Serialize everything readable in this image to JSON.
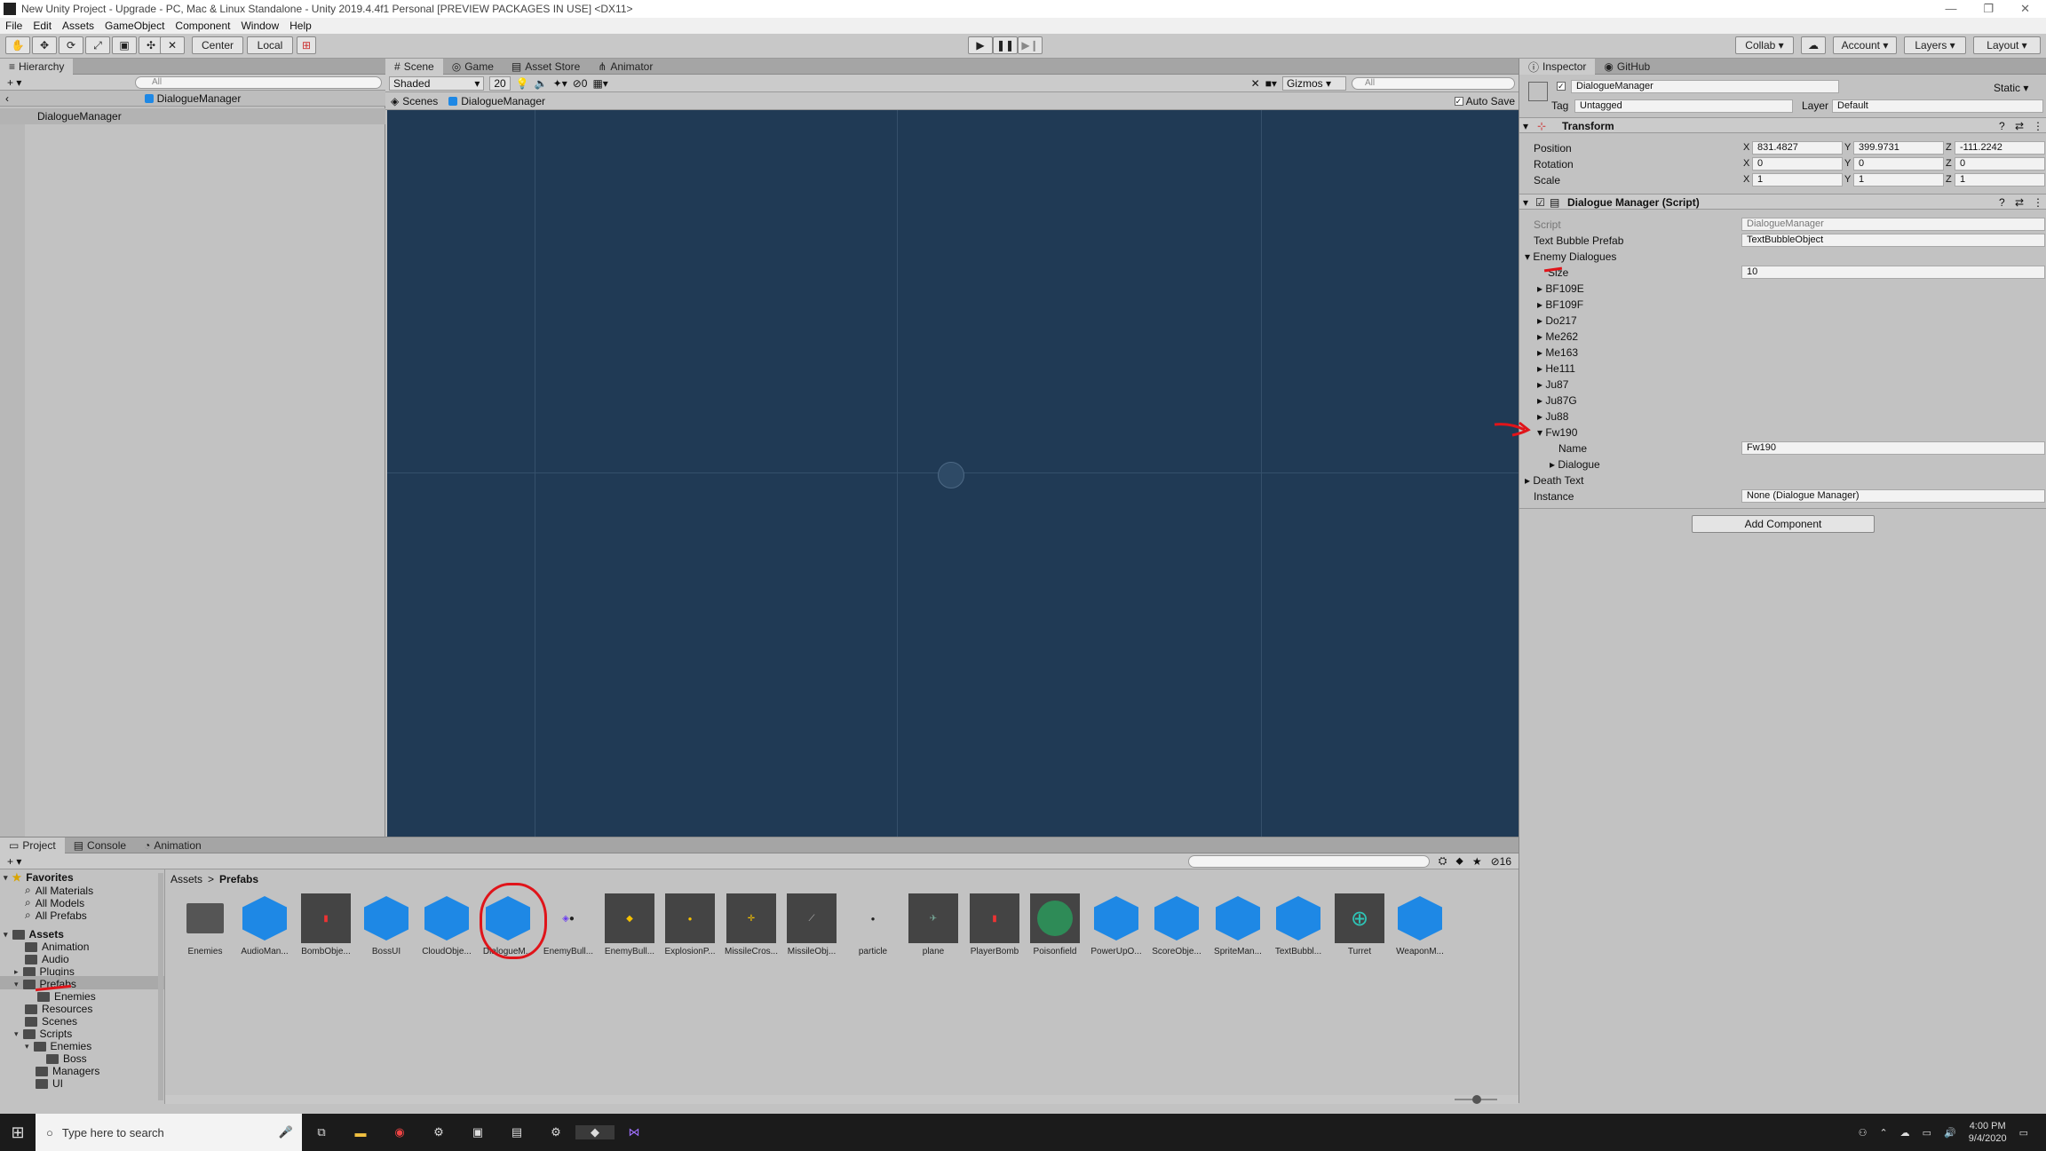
{
  "window": {
    "title": "New Unity Project - Upgrade - PC, Mac & Linux Standalone - Unity 2019.4.4f1 Personal [PREVIEW PACKAGES IN USE] <DX11>",
    "min": "—",
    "max": "❐",
    "close": "✕"
  },
  "menu": [
    "File",
    "Edit",
    "Assets",
    "GameObject",
    "Component",
    "Window",
    "Help"
  ],
  "toolbar": {
    "center": "Center",
    "local": "Local",
    "collab": "Collab ▾",
    "account": "Account ▾",
    "layers": "Layers ▾",
    "layout": "Layout ▾"
  },
  "hierarchy": {
    "tab": "Hierarchy",
    "search_placeholder": "All",
    "scene_name": "DialogueManager",
    "item": "DialogueManager"
  },
  "scene_tabs": [
    "Scene",
    "Game",
    "Asset Store",
    "Animator"
  ],
  "scene_bar": {
    "shading": "Shaded",
    "zoom": "20",
    "hidden": "0",
    "gizmos": "Gizmos",
    "search_placeholder": "All"
  },
  "breadcrumb": {
    "scenes": "Scenes",
    "current": "DialogueManager",
    "autosave": "Auto Save"
  },
  "inspector": {
    "tabs": [
      "Inspector",
      "GitHub"
    ],
    "object_name": "DialogueManager",
    "static": "Static",
    "tag_label": "Tag",
    "tag": "Untagged",
    "layer_label": "Layer",
    "layer": "Default",
    "transform": {
      "title": "Transform",
      "rows": [
        {
          "label": "Position",
          "x": "831.4827",
          "y": "399.9731",
          "z": "-111.2242"
        },
        {
          "label": "Rotation",
          "x": "0",
          "y": "0",
          "z": "0"
        },
        {
          "label": "Scale",
          "x": "1",
          "y": "1",
          "z": "1"
        }
      ]
    },
    "script": {
      "title": "Dialogue Manager (Script)",
      "script_label": "Script",
      "script_value": "DialogueManager",
      "bubble_label": "Text Bubble Prefab",
      "bubble_value": "TextBubbleObject",
      "enemy_label": "Enemy Dialogues",
      "size_label": "Size",
      "size_value": "10",
      "enemies": [
        "BF109E",
        "BF109F",
        "Do217",
        "Me262",
        "Me163",
        "He111",
        "Ju87",
        "Ju87G",
        "Ju88",
        "Fw190"
      ],
      "name_label": "Name",
      "name_value": "Fw190",
      "dialogue_label": "Dialogue",
      "death_label": "Death Text",
      "instance_label": "Instance",
      "instance_value": "None (Dialogue Manager)"
    },
    "add_component": "Add Component"
  },
  "project": {
    "tabs": [
      "Project",
      "Console",
      "Animation"
    ],
    "count": "16",
    "favorites": {
      "label": "Favorites",
      "items": [
        "All Materials",
        "All Models",
        "All Prefabs"
      ]
    },
    "assets_label": "Assets",
    "tree": [
      "Animation",
      "Audio",
      "Plugins",
      "Prefabs",
      "Enemies",
      "Resources",
      "Scenes",
      "Scripts",
      "Enemies",
      "Boss",
      "Managers",
      "UI"
    ],
    "path": {
      "root": "Assets",
      "sep": ">",
      "current": "Prefabs"
    },
    "assets": [
      "Enemies",
      "AudioMan...",
      "BombObje...",
      "BossUI",
      "CloudObje...",
      "DialogueM...",
      "EnemyBull...",
      "EnemyBull...",
      "ExplosionP...",
      "MissileCros...",
      "MissileObj...",
      "particle",
      "plane",
      "PlayerBomb",
      "Poisonfield",
      "PowerUpO...",
      "ScoreObje...",
      "SpriteMan...",
      "TextBubbl...",
      "Turret",
      "WeaponM..."
    ]
  },
  "taskbar": {
    "search": "Type here to search",
    "time": "4:00 PM",
    "date": "9/4/2020"
  },
  "colors": {
    "scene_bg": "#203a55",
    "cube": "#1e88e5",
    "annotation": "#e0141a"
  }
}
